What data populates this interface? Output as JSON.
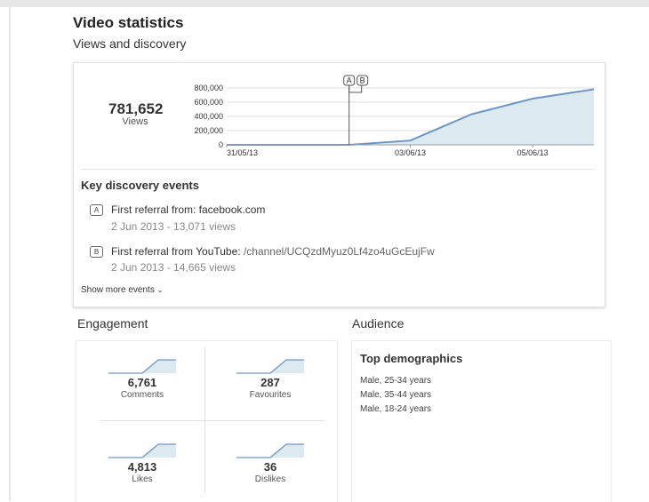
{
  "header": {
    "title": "Video statistics",
    "subtitle": "Views and discovery"
  },
  "views": {
    "total": "781,652",
    "label": "Views"
  },
  "chart_data": {
    "type": "area",
    "x": [
      "31/05/13",
      "01/06/13",
      "02/06/13",
      "03/06/13",
      "04/06/13",
      "05/06/13",
      "06/06/13"
    ],
    "series": [
      {
        "values": [
          0,
          0,
          0,
          60000,
          430000,
          650000,
          781652
        ]
      }
    ],
    "x_tick_labels": [
      "31/05/13",
      "03/06/13",
      "05/06/13"
    ],
    "y_tick_labels": [
      "800,000",
      "600,000",
      "400,000",
      "200,000",
      "0"
    ],
    "ylim": [
      0,
      800000
    ],
    "markers": [
      {
        "label": "A",
        "x": "02/06/13"
      },
      {
        "label": "B",
        "x": "02/06/13"
      }
    ],
    "grid": true,
    "colors": {
      "line": "#6e96c2",
      "fill": "#dce9ef",
      "grid": "#dcdcdc"
    }
  },
  "discovery": {
    "title": "Key discovery events",
    "events": [
      {
        "badge": "A",
        "text": "First referral from: facebook.com",
        "link": "",
        "detail": "2 Jun 2013 - 13,071 views"
      },
      {
        "badge": "B",
        "text": "First referral from YouTube: ",
        "link": "/channel/UCQzdMyuz0Lf4zo4uGcEujFw",
        "detail": "2 Jun 2013 - 14,665 views"
      }
    ],
    "show_more": "Show more events"
  },
  "engagement": {
    "title": "Engagement",
    "cells": [
      {
        "value": "6,761",
        "label": "Comments"
      },
      {
        "value": "287",
        "label": "Favourites"
      },
      {
        "value": "4,813",
        "label": "Likes"
      },
      {
        "value": "36",
        "label": "Dislikes"
      }
    ]
  },
  "audience": {
    "title": "Audience",
    "card_title": "Top demographics",
    "items": [
      "Male, 25-34 years",
      "Male, 35-44 years",
      "Male, 18-24 years"
    ]
  }
}
